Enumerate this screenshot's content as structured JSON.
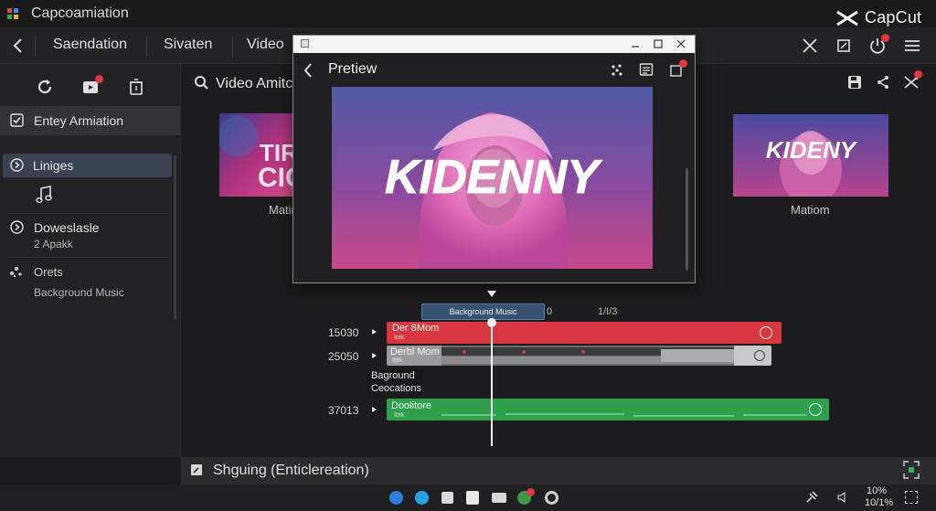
{
  "window": {
    "title": "Capcoamiation",
    "brand": "CapCut"
  },
  "nav": {
    "items": [
      "Saendation",
      "Sivaten",
      "Video"
    ]
  },
  "sidebar": {
    "header_label": "Entey Armiation",
    "items": [
      {
        "label": "Liniges"
      },
      {
        "label": "Doweslasle",
        "sub": "2 Apakk"
      },
      {
        "label": "Orets",
        "sub": "Background Music"
      }
    ]
  },
  "media": {
    "title": "Video Amitc",
    "thumbs": [
      {
        "caption": "Matin",
        "text_line1": "TIRE",
        "text_line2": "CIC"
      },
      {
        "caption": "Matiom",
        "text": "KIDENY"
      }
    ]
  },
  "preview": {
    "title": "Pretiew",
    "video_text": "KIDENNY"
  },
  "timeline": {
    "playhead_label": "Background Music",
    "ruler": [
      "0",
      "1/I/3"
    ],
    "tracks": [
      {
        "time": "15030",
        "clip_title": "Der 8Mom",
        "clip_sub": "Ibtk",
        "color": "#d8383d"
      },
      {
        "time": "25050",
        "clip_title": "Derbl Mom",
        "clip_sub": "Ibtk",
        "color": "#8e8e90"
      },
      {
        "time": "37013",
        "clip_title": "Doolitore",
        "clip_sub": "Ibtk",
        "color": "#2e9f4c"
      }
    ],
    "popup": {
      "line1": "Baground",
      "line2": "Ceocations"
    }
  },
  "status": {
    "text": "Shguing (Enticlereation)",
    "zoom_top": "10%",
    "zoom_bottom": "10/1%"
  },
  "colors": {
    "accent_red": "#e0383e",
    "selected_bg": "#3a4150",
    "green_clip": "#2e9f4c",
    "red_clip": "#d8383d"
  },
  "icons": [
    "back-icon",
    "close-icon",
    "crop-icon",
    "power-icon",
    "menu-icon",
    "refresh-icon",
    "media-import-icon",
    "delete-icon",
    "search-icon",
    "checkbox-icon",
    "info-icon",
    "music-note-icon",
    "dots-icon",
    "save-icon",
    "share-icon",
    "shuffle-icon",
    "edit-icon",
    "fullscreen-icon"
  ]
}
